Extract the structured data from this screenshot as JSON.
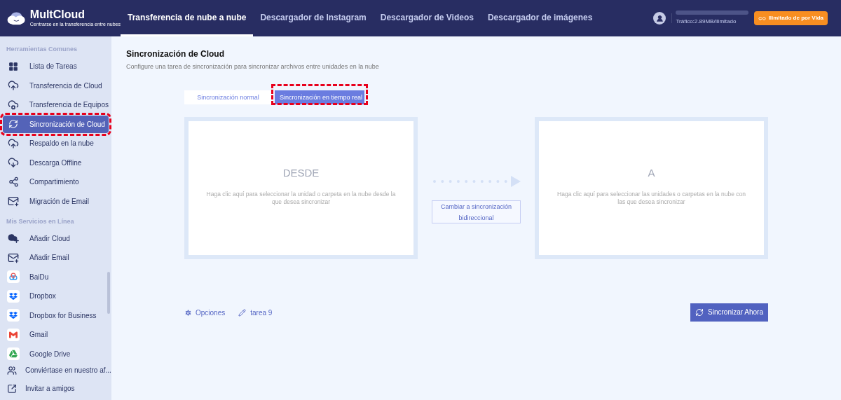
{
  "header": {
    "logo": {
      "name": "MultCloud",
      "tagline": "Centrarse en la transferencia entre nubes"
    },
    "nav": [
      {
        "label": "Transferencia de nube a nube",
        "selected": true
      },
      {
        "label": "Descargador de Instagram",
        "selected": false
      },
      {
        "label": "Descargador de Videos",
        "selected": false
      },
      {
        "label": "Descargador de imágenes",
        "selected": false
      }
    ],
    "traffic": "Tráfico:2.89MB/Ilimitado",
    "plan_button": "Ilimitado de por Vida"
  },
  "sidebar": {
    "sections": [
      {
        "title": "Herramientas Comunes",
        "items": [
          {
            "label": "Lista de Tareas",
            "selected": false,
            "highlighted": false
          },
          {
            "label": "Transferencia de Cloud",
            "selected": false,
            "highlighted": false
          },
          {
            "label": "Transferencia de Equipos",
            "selected": false,
            "highlighted": false
          },
          {
            "label": "Sincronización de Cloud",
            "selected": true,
            "highlighted": true
          },
          {
            "label": "Respaldo en la nube",
            "selected": false,
            "highlighted": false
          },
          {
            "label": "Descarga Offline",
            "selected": false,
            "highlighted": false
          },
          {
            "label": "Compartimiento",
            "selected": false,
            "highlighted": false
          },
          {
            "label": "Migración de Email",
            "selected": false,
            "highlighted": false
          }
        ]
      },
      {
        "title": "Mis Servicios en Línea",
        "items": [
          {
            "label": "Añadir Cloud",
            "selected": false,
            "highlighted": false
          },
          {
            "label": "Añadir Email",
            "selected": false,
            "highlighted": false
          },
          {
            "label": "BaiDu",
            "selected": false,
            "highlighted": false
          },
          {
            "label": "Dropbox",
            "selected": false,
            "highlighted": false
          },
          {
            "label": "Dropbox for Business",
            "selected": false,
            "highlighted": false
          },
          {
            "label": "Gmail",
            "selected": false,
            "highlighted": false
          },
          {
            "label": "Google Drive",
            "selected": false,
            "highlighted": false
          }
        ]
      }
    ],
    "footer": [
      "Conviértase en nuestro af...",
      "Invitar a amigos"
    ]
  },
  "main": {
    "title": "Sincronización de Cloud",
    "subtitle": "Configure una tarea de sincronización para sincronizar archivos entre unidades en la nube",
    "tabs": [
      {
        "label": "Sincronización normal",
        "selected": false,
        "highlighted": false
      },
      {
        "label": "Sincronización en tiempo real",
        "selected": true,
        "highlighted": true
      }
    ],
    "source": {
      "heading": "DESDE",
      "hint": "Haga clic aquí para seleccionar la unidad o carpeta en la nube desde la que desea sincronizar"
    },
    "switch_button": "Cambiar a sincronización bidireccional",
    "target": {
      "heading": "A",
      "hint": "Haga clic aquí para seleccionar las unidades o carpetas en la nube con las que desea sincronizar"
    },
    "options": "Opciones",
    "task_name": "tarea 9",
    "submit": "Sincronizar Ahora"
  }
}
